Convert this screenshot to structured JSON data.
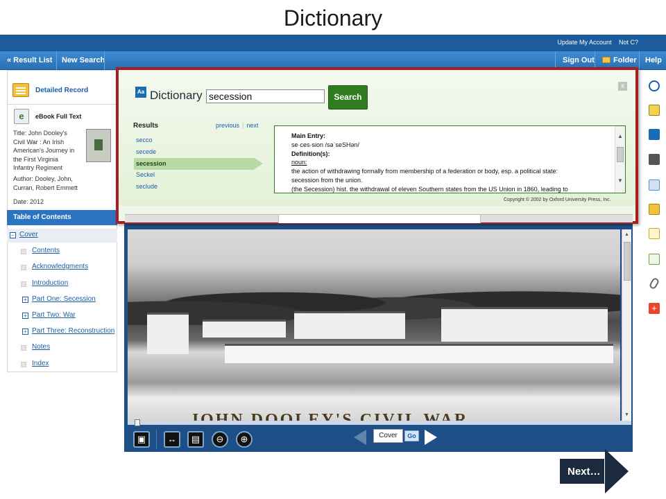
{
  "slide": {
    "title": "Dictionary"
  },
  "topbar": {
    "update_account": "Update My Account",
    "not_c": "Not C?"
  },
  "navbar": {
    "result_list": "« Result List",
    "new_search": "New Search",
    "sign_out": "Sign Out",
    "folder": "Folder",
    "help": "Help"
  },
  "sidebar": {
    "detailed_record": "Detailed Record",
    "ebook_label": "eBook Full Text",
    "title_lines": [
      "Title: John Dooley's",
      "Civil War : An Irish",
      "American's Journey in",
      "the First Virginia",
      "Infantry Regiment"
    ],
    "author_lines": [
      "Author: Dooley, John,",
      "Curran, Robert Emmett"
    ],
    "date": "Date: 2012",
    "toc_header": "Table of Contents",
    "toc_items": [
      {
        "label": "Cover",
        "kind": "minus"
      },
      {
        "label": "Contents",
        "kind": "bullet"
      },
      {
        "label": "Acknowledgments",
        "kind": "bullet"
      },
      {
        "label": "Introduction",
        "kind": "bullet"
      },
      {
        "label": "Part One: Secession",
        "kind": "plus"
      },
      {
        "label": "Part Two: War",
        "kind": "plus"
      },
      {
        "label": "Part Three: Reconstruction",
        "kind": "plus"
      },
      {
        "label": "Notes",
        "kind": "bullet"
      },
      {
        "label": "Index",
        "kind": "bullet"
      }
    ]
  },
  "dictionary": {
    "logo": "Aa",
    "title": "Dictionary",
    "query": "secession",
    "search_label": "Search",
    "close": "x",
    "results_label": "Results",
    "previous": "previous",
    "next": "next",
    "results": [
      "secco",
      "secede",
      "secession",
      "Seckel",
      "seclude"
    ],
    "selected": "secession",
    "entry": {
      "main_entry_label": "Main Entry:",
      "pronunciation": "se·ces·sion /səˈseSHən/",
      "definitions_label": "Definition(s):",
      "pos": "noun:",
      "definition": "the action of withdrawing formally from membership of a federation or body, esp. a political state:",
      "example": "secession from the union.",
      "continued": "(the Secession) hist. the withdrawal of eleven Southern states from the US Union in 1860, leading to"
    },
    "copyright": "Copyright © 2002 by Oxford University Press, Inc."
  },
  "viewer": {
    "caption": "JOHN DOOLEY'S CIVIL WAR",
    "page_value": "Cover",
    "go_label": "Go"
  },
  "next_button": {
    "label": "Next…"
  }
}
